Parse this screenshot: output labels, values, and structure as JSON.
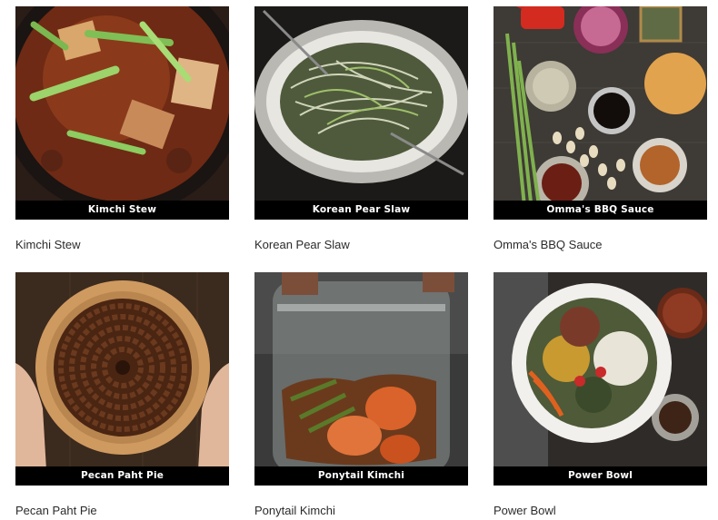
{
  "recipes": [
    {
      "caption": "Kimchi Stew",
      "title": "Kimchi Stew"
    },
    {
      "caption": "Korean Pear Slaw",
      "title": "Korean Pear Slaw"
    },
    {
      "caption": "Omma's BBQ Sauce",
      "title": "Omma's BBQ Sauce"
    },
    {
      "caption": "Pecan Paht Pie",
      "title": "Pecan Paht Pie"
    },
    {
      "caption": "Ponytail Kimchi",
      "title": "Ponytail Kimchi"
    },
    {
      "caption": "Power Bowl",
      "title": "Power Bowl"
    }
  ]
}
